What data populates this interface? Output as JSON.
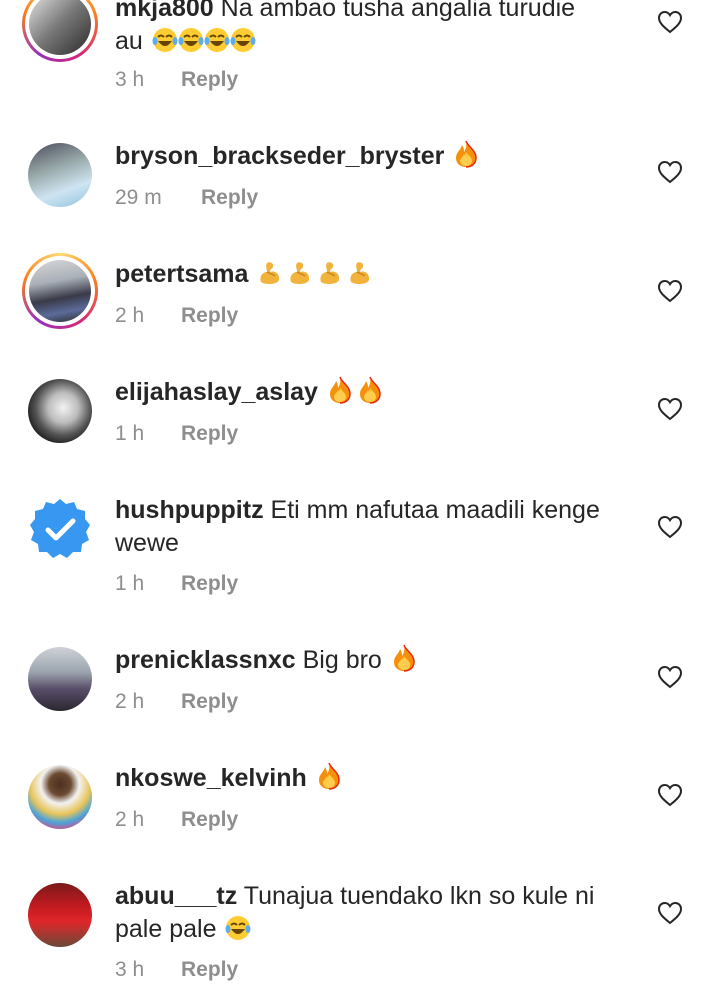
{
  "comments": [
    {
      "username": "mkja800",
      "text": " Na ambao tusha angalia turudie",
      "text2": "au",
      "time": "3 h",
      "reply": "Reply",
      "emoji_after": "laughing-tears x4"
    },
    {
      "username": "bryson_brackseder_bryster",
      "text": " ",
      "time": "29 m",
      "reply": "Reply",
      "emoji_after": "fire"
    },
    {
      "username": "petertsama",
      "text": " ",
      "time": "2 h",
      "reply": "Reply",
      "emoji_after": "flexed-biceps x4"
    },
    {
      "username": "elijahaslay_aslay",
      "text": " ",
      "time": "1 h",
      "reply": "Reply",
      "emoji_after": "fire x2"
    },
    {
      "username": "hushpuppitz",
      "text": " Eti mm nafutaa maadili kenge",
      "text2": "wewe",
      "time": "1 h",
      "reply": "Reply"
    },
    {
      "username": "prenicklassnxc",
      "text": " Big bro",
      "time": "2 h",
      "reply": "Reply",
      "emoji_after": "fire"
    },
    {
      "username": "nkoswe_kelvinh",
      "text": " ",
      "time": "2 h",
      "reply": "Reply",
      "emoji_after": "fire"
    },
    {
      "username": "abuu___tz",
      "text": " Tunajua tuendako lkn so kule ni",
      "text2": "pale pale",
      "time": "3 h",
      "reply": "Reply",
      "emoji_after": "laughing-tears"
    }
  ],
  "icons": {
    "like": "heart-outline-icon",
    "verified": "verified-badge-icon"
  },
  "colors": {
    "text": "#262626",
    "meta": "#8e8e8e",
    "verified": "#3897f0"
  }
}
